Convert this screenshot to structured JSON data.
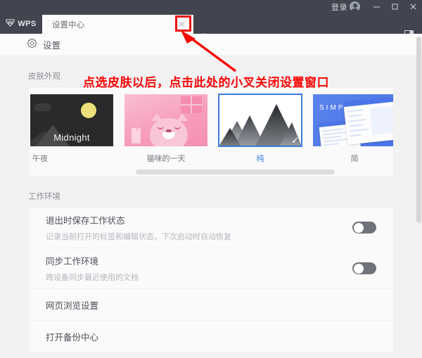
{
  "titlebar": {
    "login_label": "登录",
    "avatar_icon": "user-avatar-icon",
    "minimize_icon": "minimize-icon",
    "maximize_icon": "maximize-icon",
    "close_icon": "close-icon"
  },
  "tabbar": {
    "app_logo_text": "WPS",
    "tabs": [
      {
        "label": "设置中心",
        "close_icon": "close-icon",
        "active": true
      }
    ],
    "new_tab_icon": "plus-icon",
    "side_panel_icon": "side-panel-icon"
  },
  "settings_header": {
    "gear_icon": "gear-icon",
    "title": "设置"
  },
  "skins_section": {
    "label": "皮肤外观",
    "items": [
      {
        "name": "午夜",
        "thumb_text": "Midnight",
        "selected": false
      },
      {
        "name": "猫咪的一天",
        "thumb_text": "",
        "selected": false
      },
      {
        "name": "纯",
        "thumb_text": "",
        "selected": true
      },
      {
        "name": "简",
        "thumb_text": "SIMPLE",
        "selected": false
      }
    ],
    "selected_check_icon": "check-icon"
  },
  "workspace_section": {
    "label": "工作环境",
    "rows": [
      {
        "title": "退出时保存工作状态",
        "subtitle": "记录当前打开的标签和编辑状态，下次启动时自动恢复",
        "control": "toggle",
        "toggle_on": false
      },
      {
        "title": "同步工作环境",
        "subtitle": "跨设备同步最近使用的文档",
        "control": "toggle",
        "toggle_on": false
      },
      {
        "title": "网页浏览设置",
        "subtitle": "",
        "control": "none"
      },
      {
        "title": "打开备份中心",
        "subtitle": "",
        "control": "none"
      }
    ]
  },
  "annotation": {
    "text": "点选皮肤以后，点击此处的小叉关闭设置窗口",
    "color": "#fa0505",
    "arrow_icon": "arrow-pointer-icon",
    "highlight_box_target": "tab-close-button"
  },
  "colors": {
    "titlebar_bg": "#41454f",
    "accent_blue": "#3b7ddd",
    "annotation_red": "#fa0505",
    "content_bg": "#f2f2f2",
    "panel_bg": "#fafafa"
  }
}
